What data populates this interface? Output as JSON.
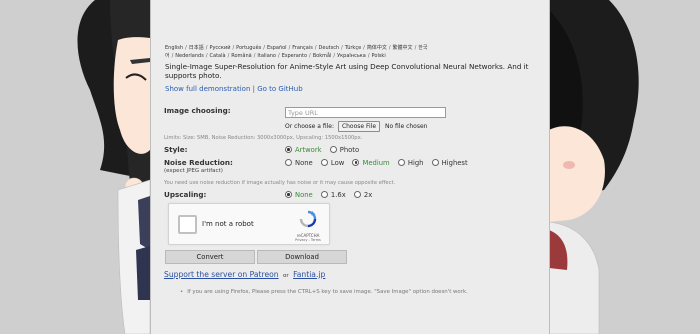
{
  "languages": [
    "English",
    "日本語",
    "Русский",
    "Português",
    "Español",
    "Français",
    "Deutsch",
    "Türkçe",
    "简体中文",
    "繁體中文",
    "한국어",
    "Nederlands",
    "Català",
    "Română",
    "Italiano",
    "Esperanto",
    "Bokmål",
    "Українська",
    "Polski"
  ],
  "description": "Single-Image Super-Resolution for Anime-Style Art using Deep Convolutional Neural Networks. And it supports photo.",
  "links": {
    "demo": "Show full demonstration",
    "separator": "|",
    "github": "Go to GitHub"
  },
  "image_choosing": {
    "label": "Image choosing:",
    "url_placeholder": "Type URL",
    "or_choose": "Or choose a file:",
    "choose_button": "Choose File",
    "no_file": "No file chosen"
  },
  "limits": "Limits: Size: 5MB, Noise Reduction: 3000x3000px, Upscaling: 1500x1500px.",
  "style": {
    "label": "Style:",
    "options": [
      "Artwork",
      "Photo"
    ],
    "selected": "Artwork"
  },
  "noise": {
    "label": "Noise Reduction:",
    "sublabel": "(expect JPEG artifact)",
    "options": [
      "None",
      "Low",
      "Medium",
      "High",
      "Highest"
    ],
    "selected": "Medium"
  },
  "noise_note": "You need use noise reduction if image actually has noise or it may cause opposite effect.",
  "upscaling": {
    "label": "Upscaling:",
    "options": [
      "None",
      "1.6x",
      "2x"
    ],
    "selected": "None"
  },
  "captcha": {
    "label": "I'm not a robot",
    "brand": "reCAPTCHA",
    "terms": "Privacy - Terms"
  },
  "buttons": {
    "convert": "Convert",
    "download": "Download"
  },
  "support": {
    "patreon": "Support the server on Patreon",
    "or": "or",
    "fantia": "Fantia.jp"
  },
  "tip": "If you are using Firefox, Please press the CTRL+S key to save image. \"Save Image\" option doesn't work.",
  "colors": {
    "page_bg": "#cfcfcf",
    "panel_bg": "#ececec",
    "link": "#2a5db0",
    "selected_option": "#3a8a3a"
  }
}
